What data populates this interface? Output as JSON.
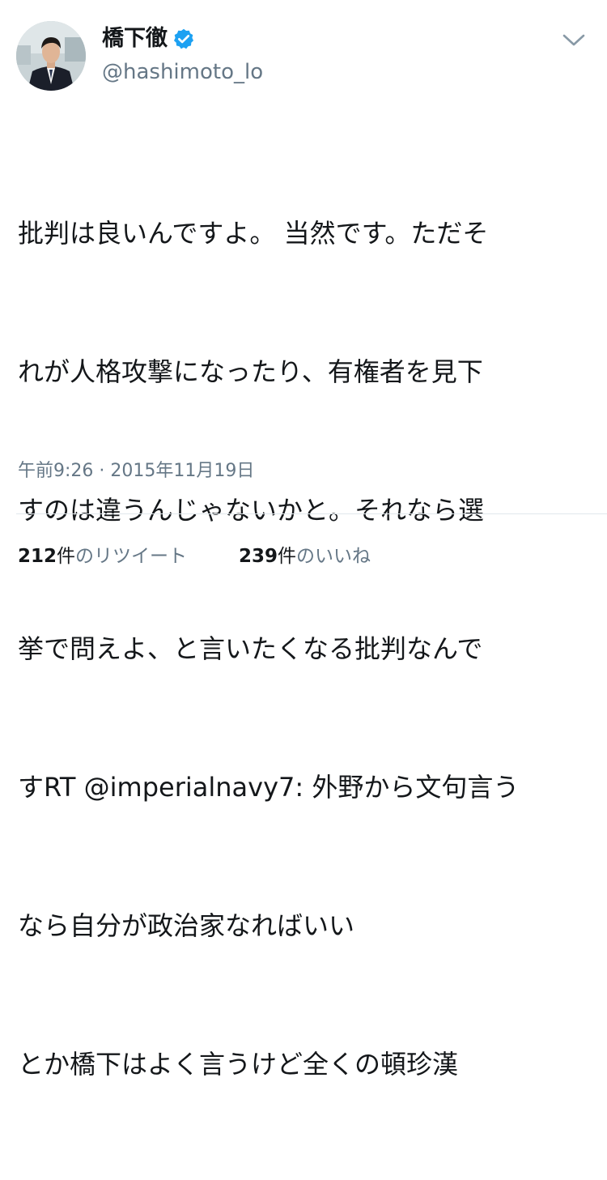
{
  "author": {
    "name": "橋下徹",
    "handle": "@hashimoto_lo",
    "verified": true
  },
  "icons": {
    "avatar": "profile-photo",
    "verified": "verified-badge-icon",
    "menu": "chevron-down-icon"
  },
  "tweet": {
    "text_lines": [
      "批判は良いんですよ。 当然です。ただそ",
      "れが人格攻撃になったり、有権者を見下",
      "すのは違うんじゃないかと。それなら選",
      "挙で問えよ、と言いたくなる批判なんで",
      "すRT @imperialnavy7: 外野から文句言う",
      "なら自分が政治家なればいい",
      "とか橋下はよく言うけど全くの頓珍漢"
    ],
    "timestamp": "午前9:26 · 2015年11月19日"
  },
  "stats": {
    "retweets": {
      "count": "212",
      "unit": "件",
      "label": "のリツイート"
    },
    "likes": {
      "count": "239",
      "unit": "件",
      "label": "のいいね"
    }
  },
  "colors": {
    "text": "#14171a",
    "secondary": "#657786",
    "verified": "#1da1f2",
    "divider": "#e1e8ed"
  }
}
